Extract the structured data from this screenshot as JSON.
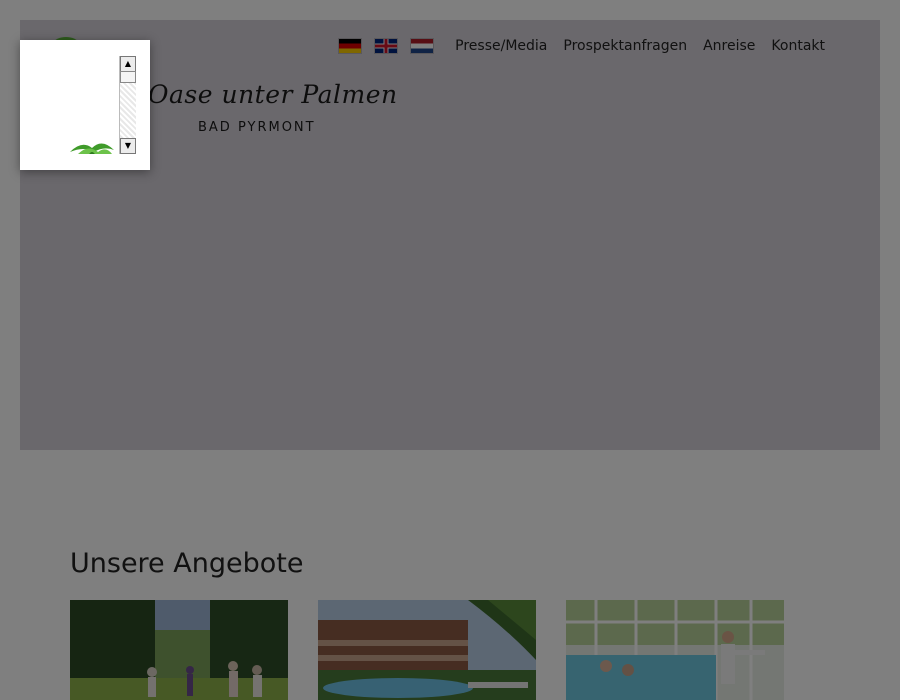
{
  "header": {
    "logo_script": "Oase unter Palmen",
    "logo_place": "Bad Pyrmont"
  },
  "nav": {
    "languages": [
      {
        "code": "de",
        "icon": "flag-germany-icon"
      },
      {
        "code": "en",
        "icon": "flag-uk-icon"
      },
      {
        "code": "nl",
        "icon": "flag-netherlands-icon"
      }
    ],
    "links": [
      "Presse/Media",
      "Prospektanfragen",
      "Anreise",
      "Kontakt"
    ]
  },
  "offers": {
    "title": "Unsere Angebote"
  },
  "popup": {
    "scroll_up_glyph": "▲",
    "scroll_down_glyph": "▼"
  },
  "colors": {
    "hero_bg": "#d4d0d8",
    "overlay": "rgba(0,0,0,0.5)",
    "palm_green": "#3f9b2a"
  }
}
